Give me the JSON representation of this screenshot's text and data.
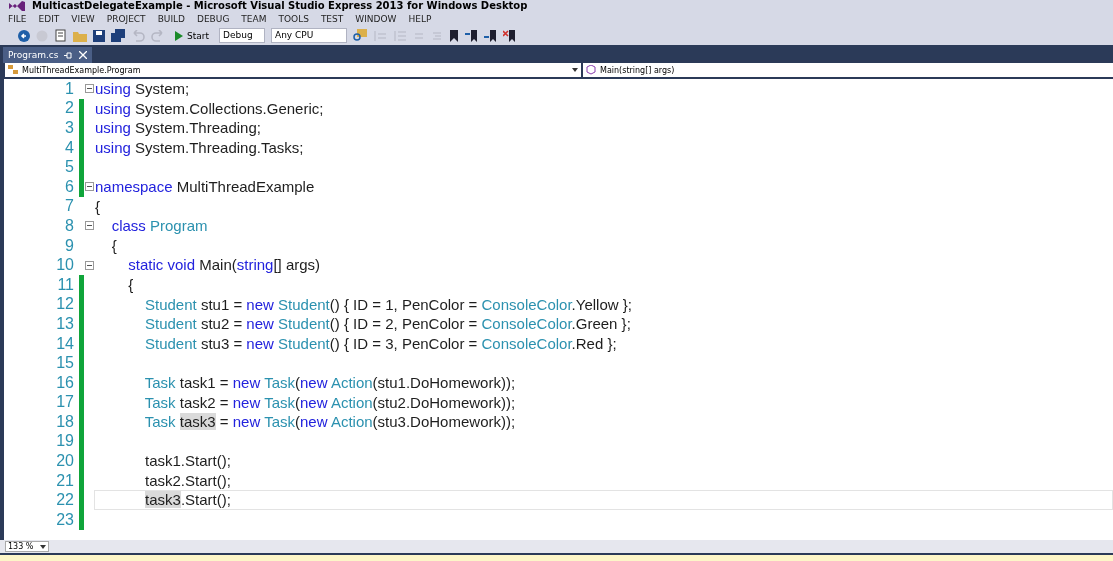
{
  "window": {
    "title": "MulticastDelegateExample - Microsoft Visual Studio Express 2013 for Windows Desktop"
  },
  "menu": [
    "FILE",
    "EDIT",
    "VIEW",
    "PROJECT",
    "BUILD",
    "DEBUG",
    "TEAM",
    "TOOLS",
    "TEST",
    "WINDOW",
    "HELP"
  ],
  "toolbar": {
    "start": "Start",
    "configuration": "Debug",
    "platform": "Any CPU"
  },
  "tabs": [
    {
      "label": "Program.cs",
      "selected": true
    }
  ],
  "navigation": {
    "type": "MultiThreadExample.Program",
    "member": "Main(string[] args)"
  },
  "lines": [
    {
      "number": "1",
      "fold": true,
      "changed": false,
      "current": false,
      "tokens": [
        {
          "kind": "kw",
          "t": "using"
        },
        {
          "kind": "plain",
          "t": " System;"
        }
      ]
    },
    {
      "number": "2",
      "fold": false,
      "changed": true,
      "current": false,
      "tokens": [
        {
          "kind": "kw",
          "t": "using"
        },
        {
          "kind": "plain",
          "t": " System.Collections.Generic;"
        }
      ]
    },
    {
      "number": "3",
      "fold": false,
      "changed": true,
      "current": false,
      "tokens": [
        {
          "kind": "kw",
          "t": "using"
        },
        {
          "kind": "plain",
          "t": " System.Threading;"
        }
      ]
    },
    {
      "number": "4",
      "fold": false,
      "changed": true,
      "current": false,
      "tokens": [
        {
          "kind": "kw",
          "t": "using"
        },
        {
          "kind": "plain",
          "t": " System.Threading.Tasks;"
        }
      ]
    },
    {
      "number": "5",
      "fold": false,
      "changed": true,
      "current": false
    },
    {
      "number": "6",
      "fold": true,
      "changed": true,
      "current": false,
      "tokens": [
        {
          "kind": "kw",
          "t": "namespace"
        },
        {
          "kind": "plain",
          "t": " MultiThreadExample"
        }
      ]
    },
    {
      "number": "7",
      "fold": false,
      "changed": false,
      "current": false,
      "tokens": [
        {
          "kind": "plain",
          "t": "{"
        }
      ]
    },
    {
      "number": "8",
      "fold": true,
      "changed": false,
      "current": false,
      "tokens": [
        {
          "kind": "kw",
          "t": "    class"
        },
        {
          "kind": "type",
          "t": " Program"
        }
      ]
    },
    {
      "number": "9",
      "fold": false,
      "changed": false,
      "current": false,
      "tokens": [
        {
          "kind": "plain",
          "t": "    {"
        }
      ]
    },
    {
      "number": "10",
      "fold": true,
      "changed": false,
      "current": false,
      "tokens": [
        {
          "kind": "kw",
          "t": "        static void"
        },
        {
          "kind": "plain",
          "t": " Main("
        },
        {
          "kind": "kw",
          "t": "string"
        },
        {
          "kind": "plain",
          "t": "[] args)"
        }
      ]
    },
    {
      "number": "11",
      "fold": false,
      "changed": true,
      "current": false,
      "tokens": [
        {
          "kind": "plain",
          "t": "        {"
        }
      ]
    },
    {
      "number": "12",
      "fold": false,
      "changed": true,
      "current": false,
      "tokens": [
        {
          "kind": "type",
          "t": "            Student"
        },
        {
          "kind": "plain",
          "t": " stu1 = "
        },
        {
          "kind": "kw",
          "t": "new"
        },
        {
          "kind": "type",
          "t": " Student"
        },
        {
          "kind": "plain",
          "t": "() { ID = 1, PenColor = "
        },
        {
          "kind": "type",
          "t": "ConsoleColor"
        },
        {
          "kind": "plain",
          "t": ".Yellow };"
        }
      ]
    },
    {
      "number": "13",
      "fold": false,
      "changed": true,
      "current": false,
      "tokens": [
        {
          "kind": "type",
          "t": "            Student"
        },
        {
          "kind": "plain",
          "t": " stu2 = "
        },
        {
          "kind": "kw",
          "t": "new"
        },
        {
          "kind": "type",
          "t": " Student"
        },
        {
          "kind": "plain",
          "t": "() { ID = 2, PenColor = "
        },
        {
          "kind": "type",
          "t": "ConsoleColor"
        },
        {
          "kind": "plain",
          "t": ".Green };"
        }
      ]
    },
    {
      "number": "14",
      "fold": false,
      "changed": true,
      "current": false,
      "tokens": [
        {
          "kind": "type",
          "t": "            Student"
        },
        {
          "kind": "plain",
          "t": " stu3 = "
        },
        {
          "kind": "kw",
          "t": "new"
        },
        {
          "kind": "type",
          "t": " Student"
        },
        {
          "kind": "plain",
          "t": "() { ID = 3, PenColor = "
        },
        {
          "kind": "type",
          "t": "ConsoleColor"
        },
        {
          "kind": "plain",
          "t": ".Red };"
        }
      ]
    },
    {
      "number": "15",
      "fold": false,
      "changed": true,
      "current": false
    },
    {
      "number": "16",
      "fold": false,
      "changed": true,
      "current": false,
      "tokens": [
        {
          "kind": "type",
          "t": "            Task"
        },
        {
          "kind": "plain",
          "t": " task1 = "
        },
        {
          "kind": "kw",
          "t": "new"
        },
        {
          "kind": "type",
          "t": " Task"
        },
        {
          "kind": "plain",
          "t": "("
        },
        {
          "kind": "kw",
          "t": "new"
        },
        {
          "kind": "type",
          "t": " Action"
        },
        {
          "kind": "plain",
          "t": "(stu1.DoHomework));"
        }
      ]
    },
    {
      "number": "17",
      "fold": false,
      "changed": true,
      "current": false,
      "tokens": [
        {
          "kind": "type",
          "t": "            Task"
        },
        {
          "kind": "plain",
          "t": " task2 = "
        },
        {
          "kind": "kw",
          "t": "new"
        },
        {
          "kind": "type",
          "t": " Task"
        },
        {
          "kind": "plain",
          "t": "("
        },
        {
          "kind": "kw",
          "t": "new"
        },
        {
          "kind": "type",
          "t": " Action"
        },
        {
          "kind": "plain",
          "t": "(stu2.DoHomework));"
        }
      ]
    },
    {
      "number": "18",
      "fold": false,
      "changed": true,
      "current": false,
      "tokens": [
        {
          "kind": "type",
          "t": "            Task"
        },
        {
          "kind": "ref",
          "t": " task3"
        },
        {
          "kind": "plain",
          "t": " = "
        },
        {
          "kind": "kw",
          "t": "new"
        },
        {
          "kind": "type",
          "t": " Task"
        },
        {
          "kind": "plain",
          "t": "("
        },
        {
          "kind": "kw",
          "t": "new"
        },
        {
          "kind": "type",
          "t": " Action"
        },
        {
          "kind": "plain",
          "t": "(stu3.DoHomework));"
        }
      ]
    },
    {
      "number": "19",
      "fold": false,
      "changed": true,
      "current": false
    },
    {
      "number": "20",
      "fold": false,
      "changed": true,
      "current": false,
      "tokens": [
        {
          "kind": "plain",
          "t": "            task1.Start();"
        }
      ]
    },
    {
      "number": "21",
      "fold": false,
      "changed": true,
      "current": false,
      "tokens": [
        {
          "kind": "plain",
          "t": "            task2.Start();"
        }
      ]
    },
    {
      "number": "22",
      "fold": false,
      "changed": true,
      "current": true,
      "tokens": [
        {
          "kind": "ref",
          "t": "            task3"
        },
        {
          "kind": "plain",
          "t": ".Start();"
        }
      ]
    },
    {
      "number": "23",
      "fold": false,
      "changed": true,
      "current": false
    }
  ],
  "zoom": "133 %"
}
